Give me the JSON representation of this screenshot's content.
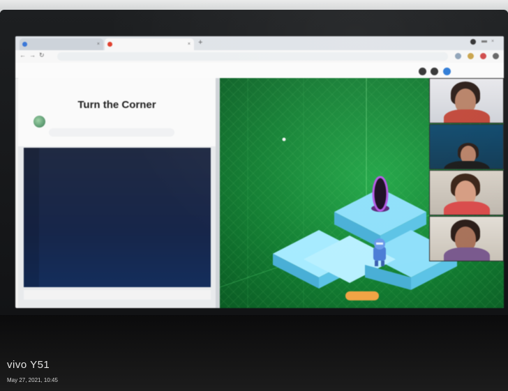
{
  "game": {
    "title": "Turn the Corner"
  },
  "camera_watermark": {
    "brand": "vivo Y51",
    "datetime": "May 27, 2021, 10:45"
  },
  "colors": {
    "editor_bg": "#1b2a4a",
    "game_green": "#1a9b3e",
    "tile_blue": "#7fd3f0",
    "run_button": "#f2a445"
  },
  "icons": [
    "logo",
    "owl-avatar-icon",
    "close-icon",
    "new-tab-icon",
    "back-icon",
    "forward-icon",
    "reload-icon",
    "portal-icon",
    "robot-icon"
  ]
}
